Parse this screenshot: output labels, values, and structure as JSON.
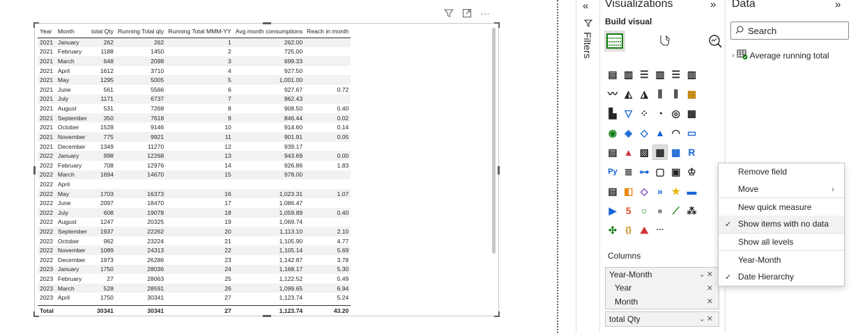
{
  "visual_header": {
    "filter_icon": "filter-icon",
    "focus_icon": "focus-mode-icon",
    "more": "···"
  },
  "table": {
    "headers": [
      "Year",
      "Month",
      "total Qty",
      "Running Total qty",
      "Running Total MMM-YY",
      "Avg month consumptions",
      "Reach in month"
    ],
    "rows": [
      [
        "2021",
        "January",
        "262",
        "262",
        "1",
        "262.00",
        ""
      ],
      [
        "2021",
        "February",
        "1188",
        "1450",
        "2",
        "725.00",
        ""
      ],
      [
        "2021",
        "March",
        "648",
        "2098",
        "3",
        "699.33",
        ""
      ],
      [
        "2021",
        "April",
        "1612",
        "3710",
        "4",
        "927.50",
        ""
      ],
      [
        "2021",
        "May",
        "1295",
        "5005",
        "5",
        "1,001.00",
        ""
      ],
      [
        "2021",
        "June",
        "561",
        "5566",
        "6",
        "927.67",
        "0.72"
      ],
      [
        "2021",
        "July",
        "1171",
        "6737",
        "7",
        "962.43",
        ""
      ],
      [
        "2021",
        "August",
        "531",
        "7268",
        "8",
        "908.50",
        "0.40"
      ],
      [
        "2021",
        "September",
        "350",
        "7618",
        "9",
        "846.44",
        "0.02"
      ],
      [
        "2021",
        "October",
        "1528",
        "9146",
        "10",
        "914.60",
        "0.14"
      ],
      [
        "2021",
        "November",
        "775",
        "9921",
        "11",
        "901.91",
        "0.05"
      ],
      [
        "2021",
        "December",
        "1349",
        "11270",
        "12",
        "939.17",
        ""
      ],
      [
        "2022",
        "January",
        "998",
        "12268",
        "13",
        "943.69",
        "0.00"
      ],
      [
        "2022",
        "February",
        "708",
        "12976",
        "14",
        "926.86",
        "1.83"
      ],
      [
        "2022",
        "March",
        "1694",
        "14670",
        "15",
        "978.00",
        ""
      ],
      [
        "2022",
        "April",
        "",
        "",
        "",
        "",
        ""
      ],
      [
        "2022",
        "May",
        "1703",
        "16373",
        "16",
        "1,023.31",
        "1.07"
      ],
      [
        "2022",
        "June",
        "2097",
        "18470",
        "17",
        "1,086.47",
        ""
      ],
      [
        "2022",
        "July",
        "608",
        "19078",
        "18",
        "1,059.89",
        "0.40"
      ],
      [
        "2022",
        "August",
        "1247",
        "20325",
        "19",
        "1,069.74",
        ""
      ],
      [
        "2022",
        "September",
        "1937",
        "22262",
        "20",
        "1,113.10",
        "2.10"
      ],
      [
        "2022",
        "October",
        "962",
        "23224",
        "21",
        "1,105.90",
        "4.77"
      ],
      [
        "2022",
        "November",
        "1089",
        "24313",
        "22",
        "1,105.14",
        "5.69"
      ],
      [
        "2022",
        "December",
        "1973",
        "26286",
        "23",
        "1,142.87",
        "3.78"
      ],
      [
        "2023",
        "January",
        "1750",
        "28036",
        "24",
        "1,168.17",
        "5.30"
      ],
      [
        "2023",
        "February",
        "27",
        "28063",
        "25",
        "1,122.52",
        "5.49"
      ],
      [
        "2023",
        "March",
        "528",
        "28591",
        "26",
        "1,099.65",
        "6.94"
      ],
      [
        "2023",
        "April",
        "1750",
        "30341",
        "27",
        "1,123.74",
        "5.24"
      ]
    ],
    "total": {
      "label": "Total",
      "total_qty": "30341",
      "running_total_qty": "30341",
      "running_total_mmm_yy": "27",
      "avg_month": "1,123.74",
      "reach": "43.20"
    }
  },
  "filters_pane": {
    "label": "Filters",
    "collapse_icon": "chevron-left-double-icon"
  },
  "visualizations_pane": {
    "title": "Visualizations",
    "collapse_glyph": "»",
    "build_visual_label": "Build visual",
    "columns_label": "Columns",
    "wells": {
      "year_month": "Year-Month",
      "year": "Year",
      "month": "Month",
      "total_qty": "total Qty"
    }
  },
  "data_pane": {
    "title": "Data",
    "collapse_glyph": "»",
    "search_placeholder": "Search",
    "table_name": "Average running total"
  },
  "context_menu": {
    "items": [
      {
        "label": "Remove field",
        "checked": false
      },
      {
        "label": "Move",
        "checked": false,
        "submenu": true
      },
      {
        "label": "New quick measure",
        "checked": false
      },
      {
        "label": "Show items with no data",
        "checked": true,
        "highlighted": true
      },
      {
        "label": "Show all levels",
        "checked": false
      },
      {
        "label": "Year-Month",
        "checked": false
      },
      {
        "label": "Date Hierarchy",
        "checked": true
      }
    ]
  },
  "colors": {
    "accent_green": "#107c10",
    "row_band": "#f3f2f1",
    "border": "#c8c6c4",
    "text": "#252423"
  }
}
